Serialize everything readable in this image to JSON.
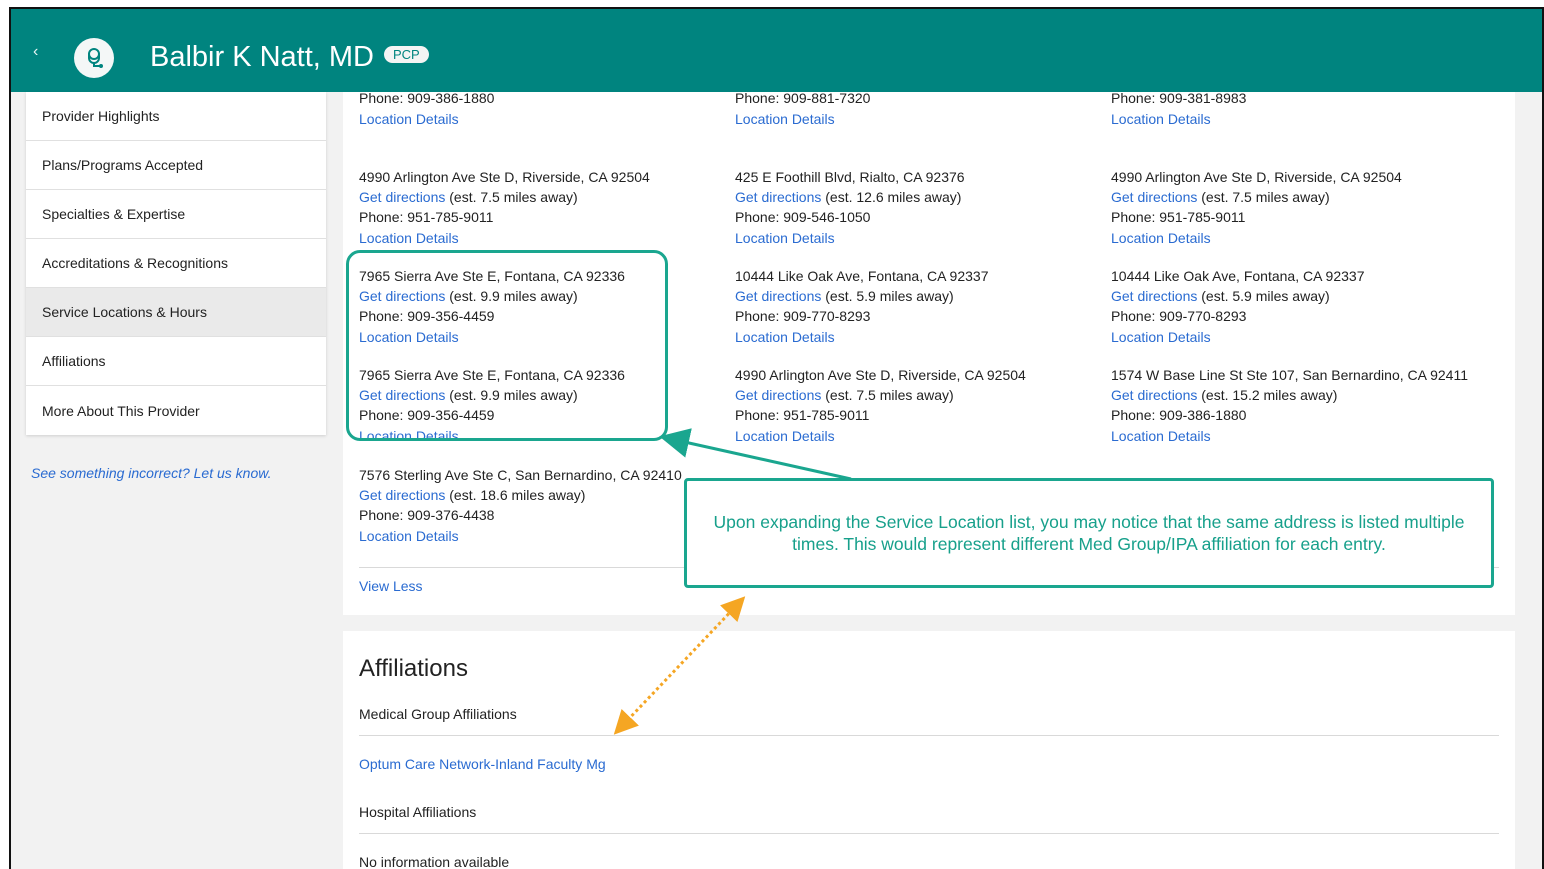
{
  "header": {
    "back_icon": "chevron-left-icon",
    "avatar_icon": "stethoscope-icon",
    "provider_name": "Balbir K Natt, MD",
    "badge": "PCP",
    "color": "#00847f"
  },
  "sidebar": {
    "items": [
      {
        "label": "Provider Highlights"
      },
      {
        "label": "Plans/Programs Accepted"
      },
      {
        "label": "Specialties & Expertise"
      },
      {
        "label": "Accreditations & Recognitions"
      },
      {
        "label": "Service Locations & Hours",
        "active": true
      },
      {
        "label": "Affiliations"
      },
      {
        "label": "More About This Provider"
      }
    ],
    "report_link": "See something incorrect? Let us know."
  },
  "locations": {
    "directions_label": "Get directions",
    "details_label": "Location Details",
    "top_partial": [
      {
        "phone": "Phone: 909-386-1880"
      },
      {
        "phone": "Phone: 909-881-7320"
      },
      {
        "phone": "Phone: 909-381-8983"
      }
    ],
    "entries": [
      {
        "address": "4990 Arlington Ave Ste D, Riverside, CA 92504",
        "distance": "(est. 7.5 miles away)",
        "phone": "Phone: 951-785-9011"
      },
      {
        "address": "425 E Foothill Blvd, Rialto, CA 92376",
        "distance": "(est. 12.6 miles away)",
        "phone": "Phone: 909-546-1050"
      },
      {
        "address": "4990 Arlington Ave Ste D, Riverside, CA 92504",
        "distance": "(est. 7.5 miles away)",
        "phone": "Phone: 951-785-9011"
      },
      {
        "address": "7965 Sierra Ave Ste E, Fontana, CA 92336",
        "distance": "(est. 9.9 miles away)",
        "phone": "Phone: 909-356-4459"
      },
      {
        "address": "10444 Like Oak Ave, Fontana, CA 92337",
        "distance": "(est. 5.9 miles away)",
        "phone": "Phone: 909-770-8293"
      },
      {
        "address": "10444 Like Oak Ave, Fontana, CA 92337",
        "distance": "(est. 5.9 miles away)",
        "phone": "Phone: 909-770-8293"
      },
      {
        "address": "7965 Sierra Ave Ste E, Fontana, CA 92336",
        "distance": "(est. 9.9 miles away)",
        "phone": "Phone: 909-356-4459"
      },
      {
        "address": "4990 Arlington Ave Ste D, Riverside, CA 92504",
        "distance": "(est. 7.5 miles away)",
        "phone": "Phone: 951-785-9011"
      },
      {
        "address": "1574 W Base Line St Ste 107, San Bernardino, CA 92411",
        "distance": "(est. 15.2 miles away)",
        "phone": "Phone: 909-386-1880"
      },
      {
        "address": "7576 Sterling Ave Ste C, San Bernardino, CA 92410",
        "distance": "(est. 18.6 miles away)",
        "phone": "Phone: 909-376-4438"
      }
    ],
    "view_less": "View Less",
    "collapse_icon": "chevron-up-icon"
  },
  "affiliations": {
    "title": "Affiliations",
    "medical_label": "Medical Group Affiliations",
    "medical_link": "Optum Care Network-Inland Faculty Mg",
    "hospital_label": "Hospital Affiliations",
    "hospital_value": "No information available"
  },
  "annotation": {
    "callout": "Upon expanding the Service Location list, you may notice that the same address is listed multiple times. This would represent different Med Group/IPA affiliation for each entry.",
    "accent_color": "#1aa68f",
    "arrow_color": "#f5a623"
  }
}
